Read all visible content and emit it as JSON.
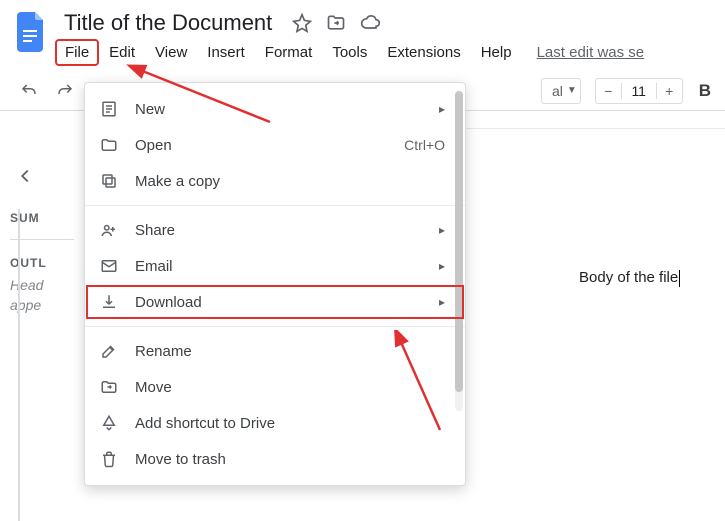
{
  "header": {
    "title": "Title of the Document",
    "last_edit": "Last edit was se"
  },
  "menubar": {
    "file": "File",
    "edit": "Edit",
    "view": "View",
    "insert": "Insert",
    "format": "Format",
    "tools": "Tools",
    "extensions": "Extensions",
    "help": "Help"
  },
  "toolbar": {
    "font_dropdown_tail": "al",
    "font_size": "11"
  },
  "sidebar": {
    "summary_label": "SUM",
    "outline_label": "OUTL",
    "outline_hint_1": "Head",
    "outline_hint_2": "appe"
  },
  "document": {
    "body_text": "Body of the file"
  },
  "file_menu": {
    "new": "New",
    "open": "Open",
    "open_shortcut": "Ctrl+O",
    "make_copy": "Make a copy",
    "share": "Share",
    "email": "Email",
    "download": "Download",
    "rename": "Rename",
    "move": "Move",
    "add_shortcut": "Add shortcut to Drive",
    "move_to_trash": "Move to trash"
  }
}
